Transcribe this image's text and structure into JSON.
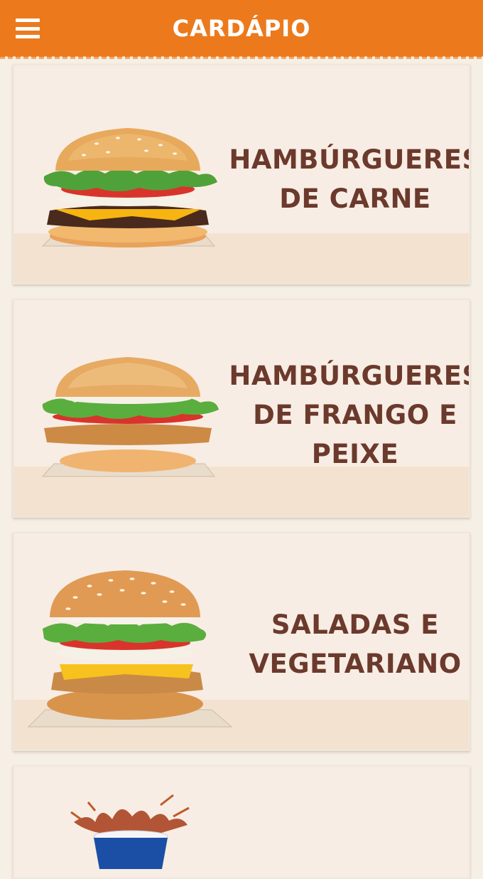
{
  "header": {
    "title": "CARDÁPIO",
    "menu_icon": "hamburger-menu-icon",
    "background": "#ec7a1c"
  },
  "categories": [
    {
      "label_line1": "HAMBÚRGUERES",
      "label_line2": "DE CARNE",
      "label_line3": "",
      "image": "beef-burger-image"
    },
    {
      "label_line1": "HAMBÚRGUERES",
      "label_line2": "DE FRANGO E",
      "label_line3": "PEIXE",
      "image": "chicken-burger-image"
    },
    {
      "label_line1": "SALADAS E",
      "label_line2": "VEGETARIANO",
      "label_line3": "",
      "image": "veggie-burger-image"
    },
    {
      "label_line1": "",
      "label_line2": "",
      "label_line3": "",
      "image": "drink-cup-image"
    }
  ],
  "colors": {
    "label_text": "#6b3a2c",
    "card_background": "#f8ede4",
    "page_background": "#f6efe5"
  }
}
